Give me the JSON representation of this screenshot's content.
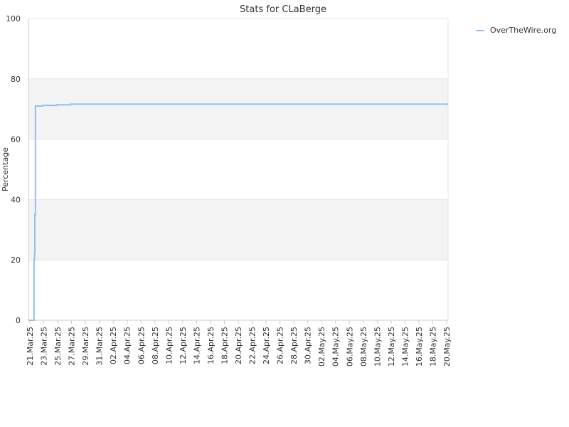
{
  "chart_data": {
    "type": "line",
    "title": "Stats for CLaBerge",
    "xlabel": "",
    "ylabel": "Percentage",
    "ylim": [
      0,
      100
    ],
    "yticks": [
      0,
      20,
      40,
      60,
      80,
      100
    ],
    "x_ticks": [
      "21.Mar.25",
      "23.Mar.25",
      "25.Mar.25",
      "27.Mar.25",
      "29.Mar.25",
      "31.Mar.25",
      "02.Apr.25",
      "04.Apr.25",
      "06.Apr.25",
      "08.Apr.25",
      "10.Apr.25",
      "12.Apr.25",
      "14.Apr.25",
      "16.Apr.25",
      "18.Apr.25",
      "20.Apr.25",
      "22.Apr.25",
      "24.Apr.25",
      "26.Apr.25",
      "28.Apr.25",
      "30.Apr.25",
      "02.May.25",
      "04.May.25",
      "06.May.25",
      "08.May.25",
      "10.May.25",
      "12.May.25",
      "14.May.25",
      "16.May.25",
      "18.May.25",
      "20.May.25"
    ],
    "xlim": [
      "2025-03-21",
      "2025-05-20"
    ],
    "grid": true,
    "legend_position": "top-right",
    "colors": {
      "series": "#90c0ee",
      "band": "#f3f3f3",
      "grid": "#e6e6e6",
      "axis": "#cccccc"
    },
    "series": [
      {
        "name": "OverTheWire.org",
        "x": [
          "2025-03-21",
          "2025-03-21",
          "2025-03-21T18:00",
          "2025-03-21T19:00",
          "2025-03-21T21:00",
          "2025-03-21T22:00",
          "2025-03-22",
          "2025-03-22T10:00",
          "2025-03-23",
          "2025-03-24",
          "2025-03-25",
          "2025-03-26",
          "2025-03-27",
          "2025-04-10",
          "2025-05-01",
          "2025-05-20"
        ],
        "y": [
          0,
          0,
          0,
          20,
          22,
          35,
          71,
          71,
          71.2,
          71.2,
          71.4,
          71.4,
          71.6,
          71.6,
          71.6,
          71.6
        ]
      }
    ]
  }
}
